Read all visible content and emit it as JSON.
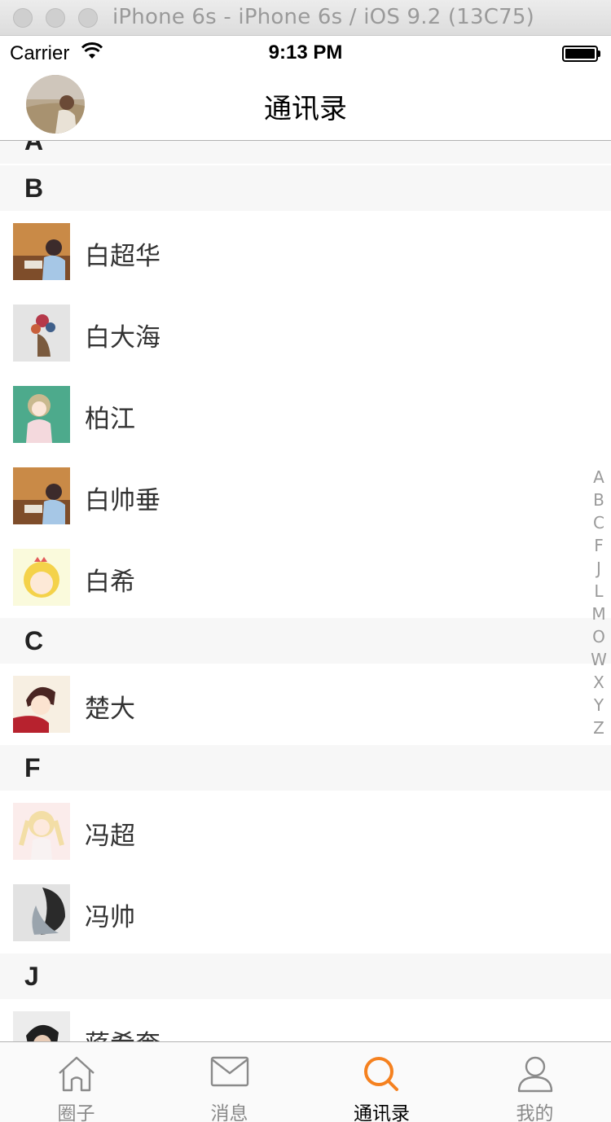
{
  "simulator": {
    "title": "iPhone 6s - iPhone 6s / iOS 9.2 (13C75)"
  },
  "status_bar": {
    "carrier": "Carrier",
    "time": "9:13 PM"
  },
  "navbar": {
    "title": "通讯录"
  },
  "sections": [
    {
      "letter": "A"
    },
    {
      "letter": "B",
      "contacts": [
        "白超华",
        "白大海",
        "柏江",
        "白帅垂",
        "白希"
      ]
    },
    {
      "letter": "C",
      "contacts": [
        "楚大"
      ]
    },
    {
      "letter": "F",
      "contacts": [
        "冯超",
        "冯帅"
      ]
    },
    {
      "letter": "J",
      "contacts": [
        "蒋希奎"
      ]
    }
  ],
  "index_letters": [
    "A",
    "B",
    "C",
    "F",
    "J",
    "L",
    "M",
    "O",
    "W",
    "X",
    "Y",
    "Z"
  ],
  "tabbar": {
    "tabs": [
      {
        "label": "圈子",
        "icon": "home-icon"
      },
      {
        "label": "消息",
        "icon": "envelope-icon"
      },
      {
        "label": "通讯录",
        "icon": "search-icon",
        "active": true
      },
      {
        "label": "我的",
        "icon": "person-icon"
      }
    ]
  },
  "colors": {
    "accent": "#F5811F",
    "section_bg": "#F7F7F7"
  }
}
